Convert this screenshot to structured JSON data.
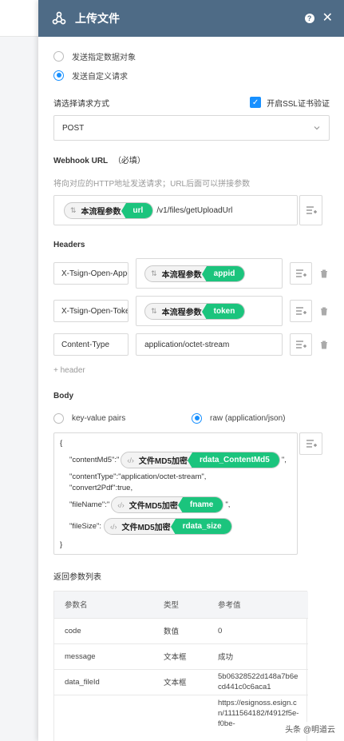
{
  "panel": {
    "title": "上传文件",
    "help_icon": "question-circle-icon",
    "close_icon": "close-icon"
  },
  "send_mode": {
    "options": [
      "发送指定数据对象",
      "发送自定义请求"
    ],
    "selected": 1
  },
  "method": {
    "label": "请选择请求方式",
    "ssl_label": "开启SSL证书验证",
    "ssl_checked": true,
    "value": "POST"
  },
  "webhook": {
    "label": "Webhook URL",
    "required": "（必填）",
    "hint": "将向对应的HTTP地址发送请求；URL后面可以拼接参数",
    "pill_source": "本流程参数",
    "pill_field": "url",
    "path": "/v1/files/getUploadUrl"
  },
  "headers": {
    "label": "Headers",
    "rows": [
      {
        "key": "X-Tsign-Open-App-Id",
        "pill_source": "本流程参数",
        "pill_field": "appid",
        "value": ""
      },
      {
        "key": "X-Tsign-Open-Token",
        "pill_source": "本流程参数",
        "pill_field": "token",
        "value": ""
      },
      {
        "key": "Content-Type",
        "pill_source": "",
        "pill_field": "",
        "value": "application/octet-stream"
      }
    ],
    "add_label": "+ header"
  },
  "body": {
    "label": "Body",
    "options": [
      "key-value pairs",
      "raw (application/json)"
    ],
    "selected": 1,
    "code": {
      "open": "{",
      "l1_key": "\"contentMd5\":\"",
      "l1_source": "文件MD5加密",
      "l1_field": "rdata_ContentMd5",
      "l1_end": "\",",
      "l2": "\"contentType\":\"application/octet-stream\",",
      "l3": "\"convert2Pdf\":true,",
      "l4_key": "\"fileName\":\"",
      "l4_source": "文件MD5加密",
      "l4_field": "fname",
      "l4_end": "\",",
      "l5_key": "\"fileSize\":",
      "l5_source": "文件MD5加密",
      "l5_field": "rdata_size",
      "close": "}"
    }
  },
  "returns": {
    "label": "返回参数列表",
    "columns": [
      "参数名",
      "类型",
      "参考值"
    ],
    "rows": [
      {
        "name": "code",
        "type": "数值",
        "ref": "0"
      },
      {
        "name": "message",
        "type": "文本框",
        "ref": "成功"
      },
      {
        "name": "data_fileId",
        "type": "文本框",
        "ref": "5b06328522d148a7b6ecd441c0c6aca1"
      },
      {
        "name": "",
        "type": "",
        "ref": "https://esignoss.esign.cn/1111564182/f4912f5e-f0be-"
      }
    ]
  },
  "watermark": "头条 @明道云"
}
